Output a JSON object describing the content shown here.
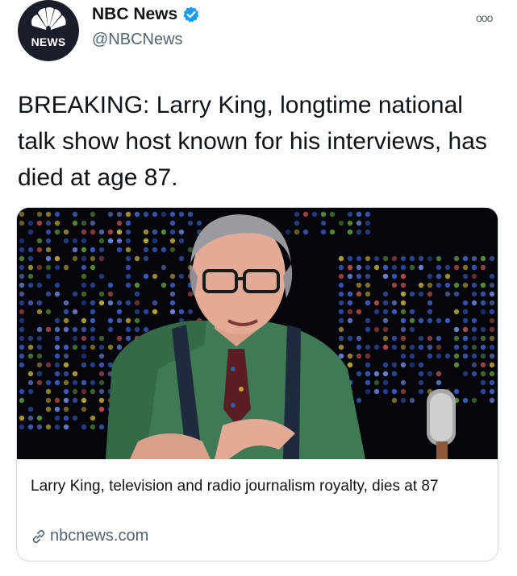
{
  "account": {
    "display_name": "NBC News",
    "handle": "@NBCNews",
    "avatar_text": "NEWS",
    "verified": true
  },
  "menu": {
    "more_label": "ooo"
  },
  "tweet": {
    "text": "BREAKING: Larry King, longtime national talk show host known for his interviews, has died at age 87."
  },
  "link_card": {
    "caption": "Larry King, television and radio journalism royalty, dies at 87",
    "domain": "nbcnews.com",
    "image_description_icon": "photo"
  },
  "colors": {
    "verified_blue": "#1d9bf0",
    "secondary_text": "#536471",
    "border": "#cfd9de"
  }
}
